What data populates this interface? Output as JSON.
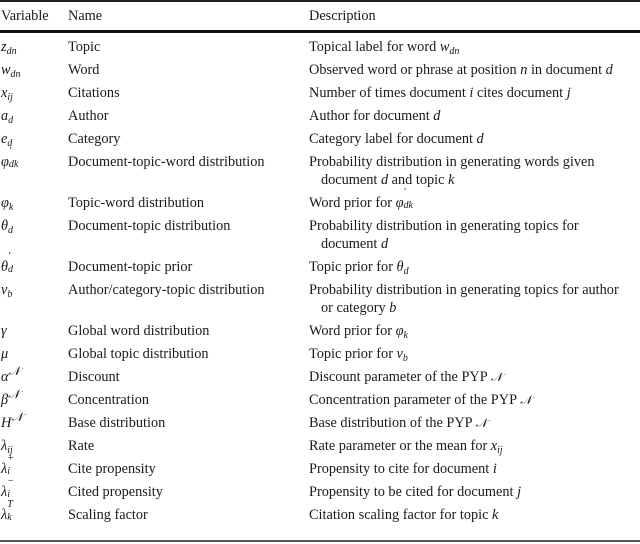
{
  "table": {
    "headers": {
      "variable": "Variable",
      "name": "Name",
      "description": "Description"
    },
    "rows": [
      {
        "var_base": "z",
        "var_sub": "dn",
        "var_sup": "",
        "name": "Topic",
        "desc": [
          {
            "t": "Topical label for word "
          },
          {
            "m": "w",
            "sub": "dn"
          }
        ]
      },
      {
        "var_base": "w",
        "var_sub": "dn",
        "var_sup": "",
        "name": "Word",
        "desc": [
          {
            "t": "Observed word or phrase at position "
          },
          {
            "m": "n"
          },
          {
            "t": " in document "
          },
          {
            "m": "d"
          }
        ]
      },
      {
        "var_base": "x",
        "var_sub": "ij",
        "var_sup": "",
        "name": "Citations",
        "desc": [
          {
            "t": "Number of times document "
          },
          {
            "m": "i"
          },
          {
            "t": " cites document "
          },
          {
            "m": "j"
          }
        ]
      },
      {
        "var_base": "a",
        "var_sub": "d",
        "var_sup": "",
        "name": "Author",
        "desc": [
          {
            "t": "Author for document "
          },
          {
            "m": "d"
          }
        ]
      },
      {
        "var_base": "e",
        "var_sub": "d",
        "var_sup": "",
        "name": "Category",
        "desc": [
          {
            "t": "Category label for document "
          },
          {
            "m": "d"
          }
        ]
      },
      {
        "var_base": "φ",
        "var_sub": "dk",
        "var_sup": "′",
        "name": "Document-topic-word distribution",
        "desc": [
          {
            "t": "Probability distribution in generating words given"
          }
        ],
        "desc2": [
          {
            "t": "document "
          },
          {
            "m": "d"
          },
          {
            "t": " and topic "
          },
          {
            "m": "k"
          }
        ]
      },
      {
        "var_base": "φ",
        "var_sub": "k",
        "var_sup": "",
        "name": "Topic-word distribution",
        "desc": [
          {
            "t": "Word prior for "
          },
          {
            "m": "φ",
            "sup": "′",
            "sub": "dk"
          }
        ]
      },
      {
        "var_base": "θ",
        "var_sub": "d",
        "var_sup": "",
        "name": "Document-topic distribution",
        "desc": [
          {
            "t": "Probability distribution in generating topics for"
          }
        ],
        "desc2": [
          {
            "t": "document "
          },
          {
            "m": "d"
          }
        ]
      },
      {
        "var_base": "θ",
        "var_sub": "d",
        "var_sup": "′",
        "name": "Document-topic prior",
        "desc": [
          {
            "t": "Topic prior for "
          },
          {
            "m": "θ",
            "sub": "d"
          }
        ]
      },
      {
        "var_base": "ν",
        "var_sub": "b",
        "var_sup": "",
        "name": "Author/category-topic distribution",
        "desc": [
          {
            "t": "Probability distribution in generating topics for author"
          }
        ],
        "desc2": [
          {
            "t": "or category "
          },
          {
            "m": "b"
          }
        ]
      },
      {
        "var_base": "γ",
        "var_sub": "",
        "var_sup": "",
        "name": "Global word distribution",
        "desc": [
          {
            "t": "Word prior for "
          },
          {
            "m": "φ",
            "sub": "k"
          }
        ]
      },
      {
        "var_base": "μ",
        "var_sub": "",
        "var_sup": "",
        "name": "Global topic distribution",
        "desc": [
          {
            "t": "Topic prior for "
          },
          {
            "m": "ν",
            "sub": "b"
          }
        ]
      },
      {
        "var_base": "α",
        "var_sub": "",
        "var_sup": "𝒩",
        "name": "Discount",
        "desc": [
          {
            "t": "Discount parameter of the PYP "
          },
          {
            "cal": "𝒩"
          }
        ]
      },
      {
        "var_base": "β",
        "var_sub": "",
        "var_sup": "𝒩",
        "name": "Concentration",
        "desc": [
          {
            "t": "Concentration parameter of the PYP "
          },
          {
            "cal": "𝒩"
          }
        ]
      },
      {
        "var_base": "H",
        "var_sub": "",
        "var_sup": "𝒩",
        "name": "Base distribution",
        "desc": [
          {
            "t": "Base distribution of the PYP "
          },
          {
            "cal": "𝒩"
          }
        ]
      },
      {
        "var_base": "λ",
        "var_sub": "ij",
        "var_sup": "",
        "name": "Rate",
        "desc": [
          {
            "t": "Rate parameter or the mean for "
          },
          {
            "m": "x",
            "sub": "ij"
          }
        ]
      },
      {
        "var_base": "λ",
        "var_sub": "i",
        "var_sup": "+",
        "name": "Cite propensity",
        "desc": [
          {
            "t": "Propensity to cite for document "
          },
          {
            "m": "i"
          }
        ]
      },
      {
        "var_base": "λ",
        "var_sub": "i",
        "var_sup": "−",
        "name": "Cited propensity",
        "desc": [
          {
            "t": "Propensity to be cited for document "
          },
          {
            "m": "j"
          }
        ]
      },
      {
        "var_base": "λ",
        "var_sub": "k",
        "var_sup": "T",
        "name": "Scaling factor",
        "desc": [
          {
            "t": "Citation scaling factor for topic "
          },
          {
            "m": "k"
          }
        ]
      }
    ]
  }
}
